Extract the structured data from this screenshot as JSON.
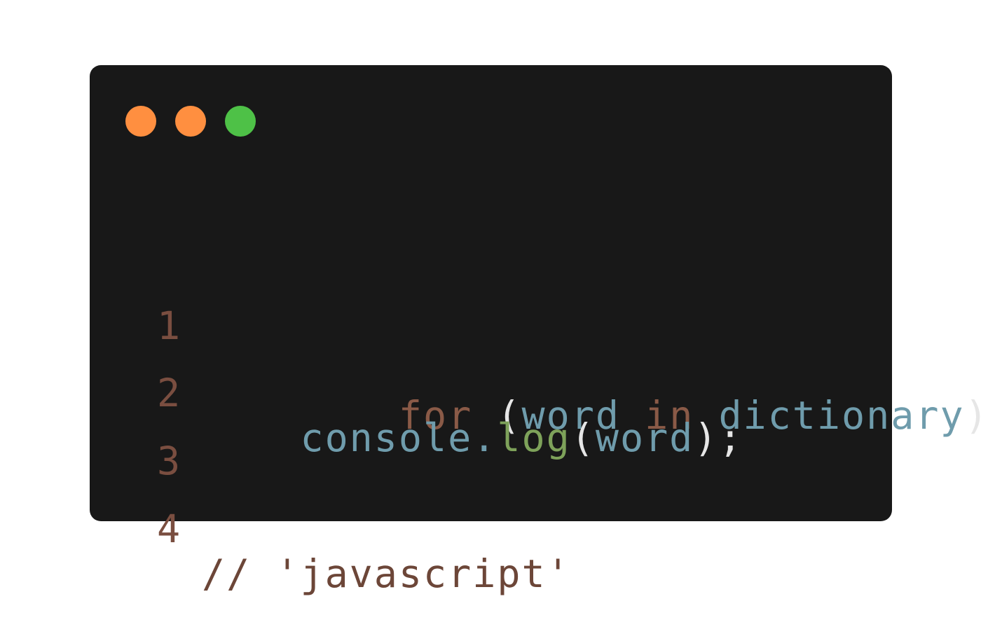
{
  "colors": {
    "background": "#ffffff",
    "window": "#181818",
    "dot_orange": "#ff8f40",
    "dot_green": "#4ec147",
    "line_number": "#7a4e40",
    "keyword": "#8a5a47",
    "variable": "#6f9cac",
    "function": "#7ea25a",
    "punctuation": "#e6e6e6",
    "comment": "#6c4638"
  },
  "window_controls": {
    "dots": [
      {
        "name": "close-dot",
        "color": "#ff8f40"
      },
      {
        "name": "minimize-dot",
        "color": "#ff8f40"
      },
      {
        "name": "maximize-dot",
        "color": "#4ec147"
      }
    ]
  },
  "code": {
    "lines": [
      {
        "number": "1",
        "tokens": [
          {
            "text": "for",
            "role": "keyword"
          },
          {
            "text": " ",
            "role": "punctuation"
          },
          {
            "text": "(",
            "role": "punctuation"
          },
          {
            "text": "word",
            "role": "variable"
          },
          {
            "text": " ",
            "role": "punctuation"
          },
          {
            "text": "in",
            "role": "keyword"
          },
          {
            "text": " ",
            "role": "punctuation"
          },
          {
            "text": "dictionary",
            "role": "variable"
          },
          {
            "text": ")",
            "role": "punctuation"
          }
        ]
      },
      {
        "number": "2",
        "tokens": [
          {
            "text": "    ",
            "role": "punctuation"
          },
          {
            "text": "console",
            "role": "variable"
          },
          {
            "text": ".",
            "role": "variable"
          },
          {
            "text": "log",
            "role": "function"
          },
          {
            "text": "(",
            "role": "punctuation"
          },
          {
            "text": "word",
            "role": "variable"
          },
          {
            "text": ")",
            "role": "punctuation"
          },
          {
            "text": ";",
            "role": "punctuation"
          }
        ]
      },
      {
        "number": "3",
        "tokens": []
      },
      {
        "number": "4",
        "tokens": [
          {
            "text": "// 'javascript'",
            "role": "comment"
          }
        ]
      }
    ]
  }
}
